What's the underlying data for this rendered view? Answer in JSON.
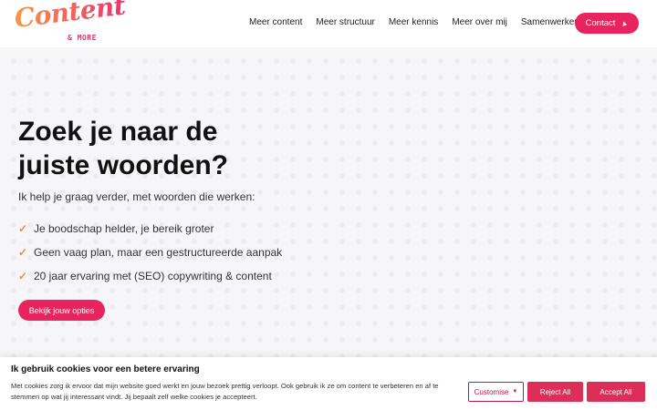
{
  "header": {
    "logo": {
      "main": "Content",
      "sub": "& MORE"
    },
    "nav": [
      {
        "label": "Meer content"
      },
      {
        "label": "Meer structuur"
      },
      {
        "label": "Meer kennis"
      },
      {
        "label": "Meer over mij"
      },
      {
        "label": "Samenwerken?"
      }
    ],
    "contact_label": "Contact",
    "contact_icon": "cursor-pointer-icon"
  },
  "hero": {
    "title_line1": "Zoek je naar de",
    "title_line2": "juiste woorden?",
    "intro": "Ik help je graag verder, met woorden die werken:",
    "checks": [
      "Je boodschap helder, je bereik groter",
      "Geen vaag plan, maar een gestructureerde aanpak",
      "20 jaar ervaring met (SEO) copywriting & content"
    ],
    "check_icon": "checkmark-icon",
    "cta_label": "Bekijk jouw opties"
  },
  "cookie": {
    "title": "Ik gebruik cookies voor een betere ervaring",
    "text": "Met cookies zorg ik ervoor dat mijn website goed werkt en jouw bezoek prettig verloopt. Ook gebruik ik ze om content te verbeteren en af te stemmen op wat jij interessant vindt. Jij bepaalt zelf welke cookies je accepteert.",
    "customise_label": "Customise",
    "reject_label": "Reject All",
    "accept_label": "Accept All"
  },
  "colors": {
    "brand_pink": "#e8245f",
    "brand_orange": "#f08a3c",
    "cookie_button": "#dd2e57",
    "customise_border": "#b5184d"
  }
}
